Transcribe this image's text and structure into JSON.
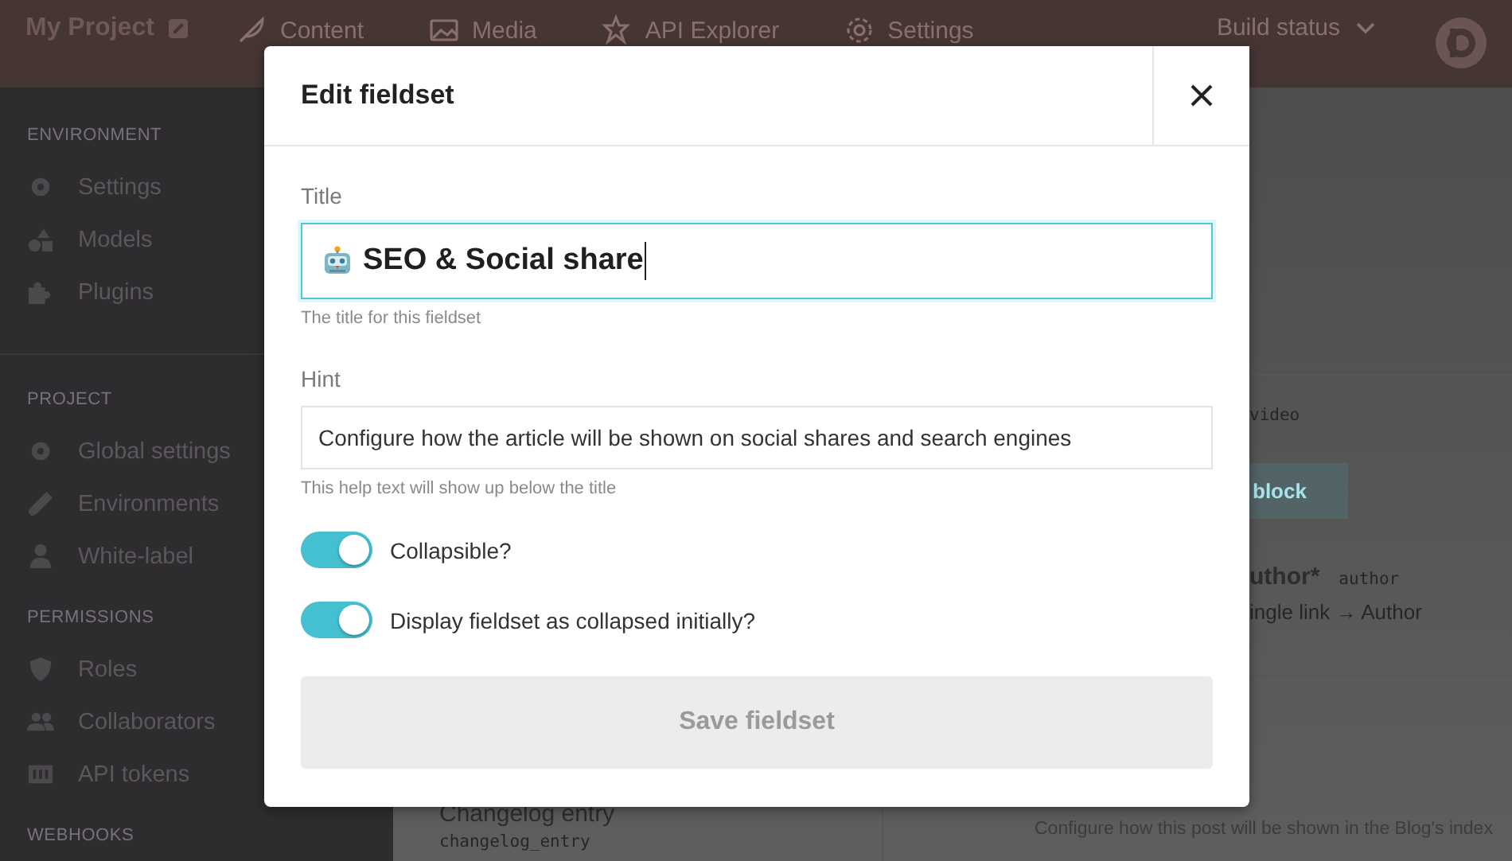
{
  "topbar": {
    "project": "My Project",
    "nav": [
      {
        "label": "Content"
      },
      {
        "label": "Media"
      },
      {
        "label": "API Explorer"
      },
      {
        "label": "Settings"
      }
    ],
    "build_status": "Build status"
  },
  "sidebar": {
    "sections": [
      {
        "heading": "ENVIRONMENT",
        "items": [
          "Settings",
          "Models",
          "Plugins"
        ]
      },
      {
        "heading": "PROJECT",
        "items": [
          "Global settings",
          "Environments",
          "White-label"
        ]
      },
      {
        "heading": "PERMISSIONS",
        "items": [
          "Roles",
          "Collaborators",
          "API tokens"
        ]
      },
      {
        "heading": "WEBHOOKS"
      }
    ]
  },
  "background": {
    "video_key": "video",
    "block_button": "block",
    "author_label": "uthor*",
    "author_key": "author",
    "author_type": "ingle link → Author",
    "changelog_title": "Changelog entry",
    "changelog_key": "changelog_entry",
    "fieldset_hint": "Configure how this post will be shown in the Blog's index"
  },
  "modal": {
    "title": "Edit fieldset",
    "title_field": {
      "label": "Title",
      "value": "SEO & Social share",
      "help": "The title for this fieldset"
    },
    "hint_field": {
      "label": "Hint",
      "value": "Configure how the article will be shown on social shares and search engines",
      "help": "This help text will show up below the title"
    },
    "toggles": [
      {
        "label": "Collapsible?",
        "on": true
      },
      {
        "label": "Display fieldset as collapsed initially?",
        "on": true
      }
    ],
    "save_button": {
      "label": "Save fieldset",
      "disabled": true
    }
  }
}
